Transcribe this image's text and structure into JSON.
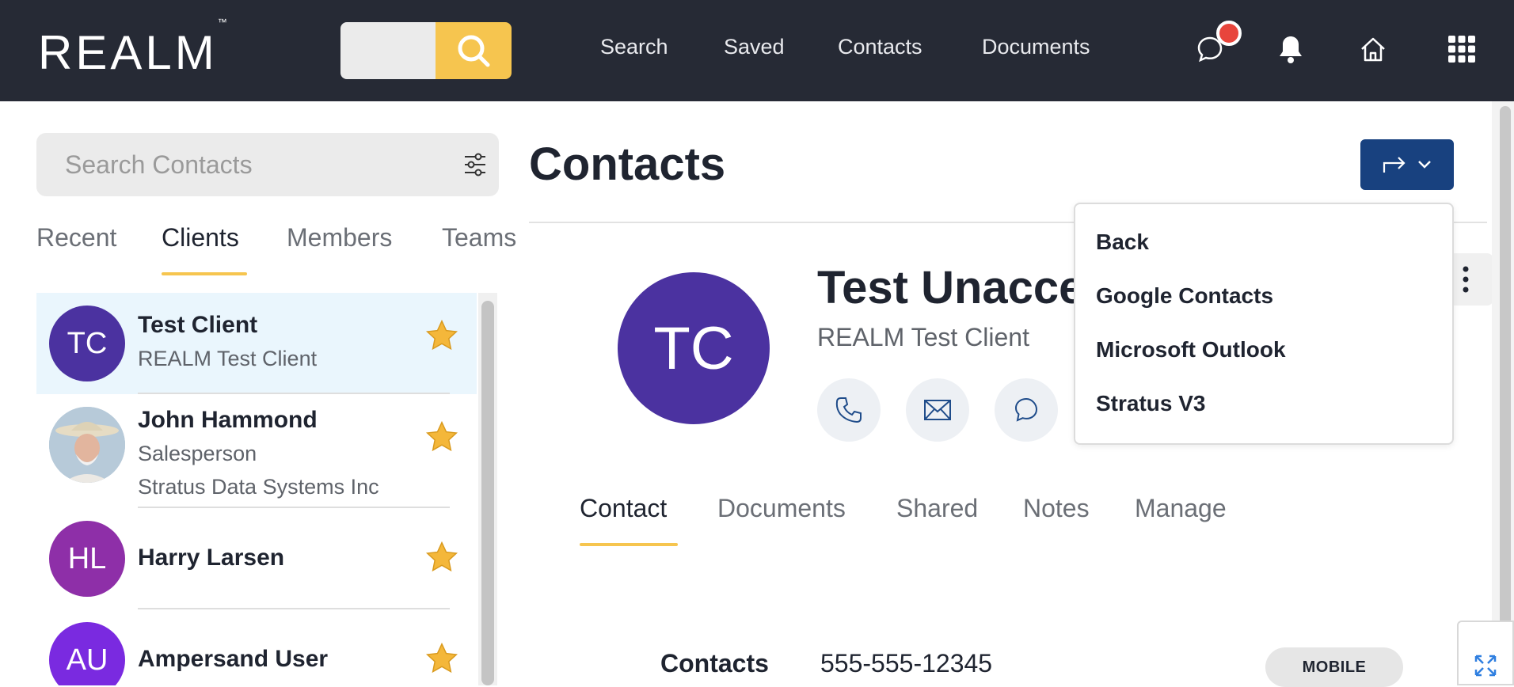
{
  "header": {
    "logo": "REALM",
    "logo_tm": "™",
    "nav": [
      "Search",
      "Saved",
      "Contacts",
      "Documents"
    ],
    "icons": [
      "chat-icon",
      "bell-icon",
      "home-icon",
      "apps-grid-icon"
    ]
  },
  "sidebar": {
    "search_placeholder": "Search Contacts",
    "tabs": [
      "Recent",
      "Clients",
      "Members",
      "Teams"
    ],
    "active_tab": "Clients",
    "contacts": [
      {
        "initials": "TC",
        "name": "Test Client",
        "sub1": "REALM Test Client",
        "sub2": "",
        "color": "#4b32a0",
        "starred": true,
        "selected": true
      },
      {
        "initials": "",
        "name": "John Hammond",
        "sub1": "Salesperson",
        "sub2": "Stratus Data Systems Inc",
        "color": "#9fb6c8",
        "starred": true,
        "selected": false
      },
      {
        "initials": "HL",
        "name": "Harry Larsen",
        "sub1": "",
        "sub2": "",
        "color": "#8e2fa8",
        "starred": true,
        "selected": false
      },
      {
        "initials": "AU",
        "name": "Ampersand User",
        "sub1": "",
        "sub2": "",
        "color": "#7a2ae0",
        "starred": true,
        "selected": false
      }
    ]
  },
  "main": {
    "title": "Contacts",
    "contact": {
      "initials": "TC",
      "name": "Test Unacce",
      "company": "REALM Test Client",
      "avatar_color": "#4b32a0"
    },
    "tabs": [
      "Contact",
      "Documents",
      "Shared",
      "Notes",
      "Manage"
    ],
    "active_tab": "Contact",
    "field": {
      "label": "Contacts",
      "value": "555-555-12345",
      "type": "MOBILE"
    }
  },
  "export_menu": {
    "items": [
      "Back",
      "Google Contacts",
      "Microsoft Outlook",
      "Stratus V3"
    ]
  },
  "colors": {
    "accent": "#f6c54f",
    "header_bg": "#262a35",
    "primary_button": "#18417f",
    "star": "#f4b73a"
  }
}
